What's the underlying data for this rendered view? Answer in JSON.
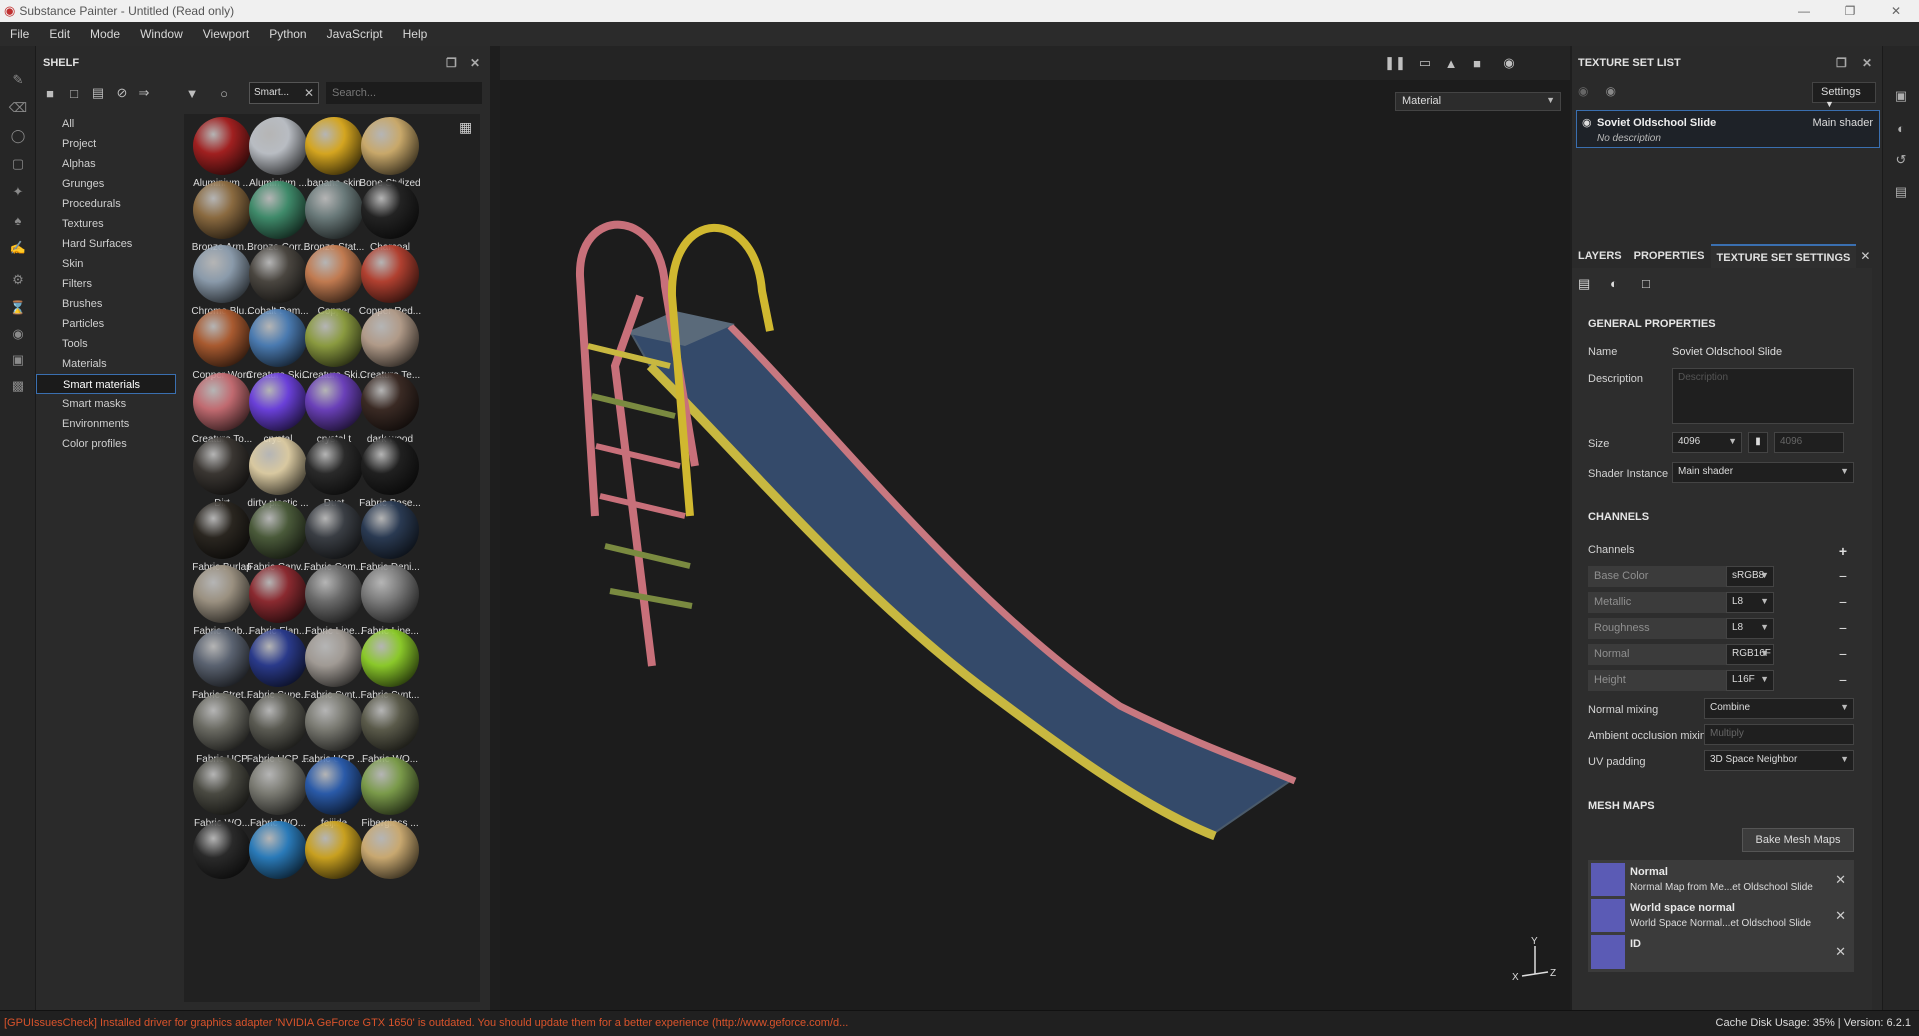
{
  "window": {
    "title": "Substance Painter - Untitled (Read only)"
  },
  "menu": [
    "File",
    "Edit",
    "Mode",
    "Window",
    "Viewport",
    "Python",
    "JavaScript",
    "Help"
  ],
  "shelf": {
    "title": "SHELF",
    "filter_tag": "Smart...",
    "search_placeholder": "Search...",
    "categories": [
      "All",
      "Project",
      "Alphas",
      "Grunges",
      "Procedurals",
      "Textures",
      "Hard Surfaces",
      "Skin",
      "Filters",
      "Brushes",
      "Particles",
      "Tools",
      "Materials",
      "Smart materials",
      "Smart masks",
      "Environments",
      "Color profiles"
    ],
    "selected_category": "Smart materials",
    "materials": [
      {
        "label": "Aluminium ...",
        "color": "#a02020"
      },
      {
        "label": "Aluminium ...",
        "color": "#b8bcc2"
      },
      {
        "label": "banana skin",
        "color": "#d4a520"
      },
      {
        "label": "Bone Stylized",
        "color": "#c8a86a"
      },
      {
        "label": "Bronze Arm...",
        "color": "#8a6a40"
      },
      {
        "label": "Bronze Corr...",
        "color": "#3f8a6a"
      },
      {
        "label": "Bronze Stat...",
        "color": "#6a7a7a"
      },
      {
        "label": "Charcoal",
        "color": "#232323"
      },
      {
        "label": "Chrome Blu...",
        "color": "#8a9aaa"
      },
      {
        "label": "Cobalt Dam...",
        "color": "#4a4640"
      },
      {
        "label": "Copper",
        "color": "#c07a50"
      },
      {
        "label": "Copper Red...",
        "color": "#b04030"
      },
      {
        "label": "Copper Worn",
        "color": "#a85a30"
      },
      {
        "label": "Creature Ski...",
        "color": "#4a7ab0"
      },
      {
        "label": "Creature Ski...",
        "color": "#8a9a40"
      },
      {
        "label": "Creature Te...",
        "color": "#b09a88"
      },
      {
        "label": "Creature To...",
        "color": "#c06a70"
      },
      {
        "label": "crystal",
        "color": "#6a40d8"
      },
      {
        "label": "crystal t",
        "color": "#6a40b8"
      },
      {
        "label": "dark wood",
        "color": "#3a2a24"
      },
      {
        "label": "Dirt",
        "color": "#3a3632"
      },
      {
        "label": "dirty plastic ...",
        "color": "#d8c8a0"
      },
      {
        "label": "Dust",
        "color": "#2a2a2a"
      },
      {
        "label": "Fabric Base...",
        "color": "#202020"
      },
      {
        "label": "Fabric Burlap",
        "color": "#2a2620"
      },
      {
        "label": "Fabric Canv...",
        "color": "#4a5a3a"
      },
      {
        "label": "Fabric Com...",
        "color": "#3a3e44"
      },
      {
        "label": "Fabric Deni...",
        "color": "#2a3a52"
      },
      {
        "label": "Fabric Dob...",
        "color": "#9a9080"
      },
      {
        "label": "Fabric Flan...",
        "color": "#8a2a30"
      },
      {
        "label": "Fabric Line...",
        "color": "#6a6a6a"
      },
      {
        "label": "Fabric Line...",
        "color": "#7a7a7a"
      },
      {
        "label": "Fabric Stret...",
        "color": "#5a6270"
      },
      {
        "label": "Fabric Supe...",
        "color": "#2a3a8a"
      },
      {
        "label": "Fabric Synt...",
        "color": "#a09a94"
      },
      {
        "label": "Fabric Synt...",
        "color": "#8ac82a"
      },
      {
        "label": "Fabric UCP",
        "color": "#6a6a62"
      },
      {
        "label": "Fabric UCP ...",
        "color": "#5a5a52"
      },
      {
        "label": "Fabric UCP ...",
        "color": "#7a7a72"
      },
      {
        "label": "Fabric WO...",
        "color": "#5a5a4a"
      },
      {
        "label": "Fabric WO...",
        "color": "#4a4a42"
      },
      {
        "label": "Fabric WO...",
        "color": "#7a7a72"
      },
      {
        "label": "feijide",
        "color": "#2a5aa8"
      },
      {
        "label": "Fiberglass ...",
        "color": "#7a9a4a"
      },
      {
        "label": "",
        "color": "#2a2a2a"
      },
      {
        "label": "",
        "color": "#2a7ab8"
      },
      {
        "label": "",
        "color": "#c8a020"
      },
      {
        "label": "",
        "color": "#c8a870"
      }
    ]
  },
  "viewport": {
    "material_mode": "Material",
    "axis_y": "Y",
    "axis_x": "X",
    "axis_z": "Z"
  },
  "texture_set_list": {
    "title": "TEXTURE SET LIST",
    "settings_label": "Settings",
    "item": {
      "name": "Soviet Oldschool Slide",
      "description": "No description",
      "shader": "Main shader"
    }
  },
  "tabs": [
    "LAYERS",
    "PROPERTIES",
    "TEXTURE SET SETTINGS"
  ],
  "texture_set_settings": {
    "general_title": "GENERAL PROPERTIES",
    "name_label": "Name",
    "name_value": "Soviet Oldschool Slide",
    "description_label": "Description",
    "description_placeholder": "Description",
    "size_label": "Size",
    "size_value": "4096",
    "size_value_locked": "4096",
    "shader_label": "Shader Instance",
    "shader_value": "Main shader",
    "channels_title": "CHANNELS",
    "channels_label": "Channels",
    "channels": [
      {
        "name": "Base Color",
        "format": "sRGB8"
      },
      {
        "name": "Metallic",
        "format": "L8"
      },
      {
        "name": "Roughness",
        "format": "L8"
      },
      {
        "name": "Normal",
        "format": "RGB16F"
      },
      {
        "name": "Height",
        "format": "L16F"
      }
    ],
    "normal_mixing_label": "Normal mixing",
    "normal_mixing_value": "Combine",
    "ao_mixing_label": "Ambient occlusion mixing",
    "ao_mixing_value": "Multiply",
    "uv_padding_label": "UV padding",
    "uv_padding_value": "3D Space Neighbor",
    "mesh_maps_title": "MESH MAPS",
    "bake_label": "Bake Mesh Maps",
    "mesh_maps": [
      {
        "title": "Normal",
        "subtitle": "Normal Map from Me...et Oldschool Slide"
      },
      {
        "title": "World space normal",
        "subtitle": "World Space Normal...et Oldschool Slide"
      },
      {
        "title": "ID",
        "subtitle": ""
      }
    ]
  },
  "status": {
    "message": "[GPUIssuesCheck] Installed driver for graphics adapter 'NVIDIA GeForce GTX 1650' is outdated. You should update them for a better experience (http://www.geforce.com/d...",
    "right": "Cache Disk Usage:   35% | Version: 6.2.1"
  }
}
